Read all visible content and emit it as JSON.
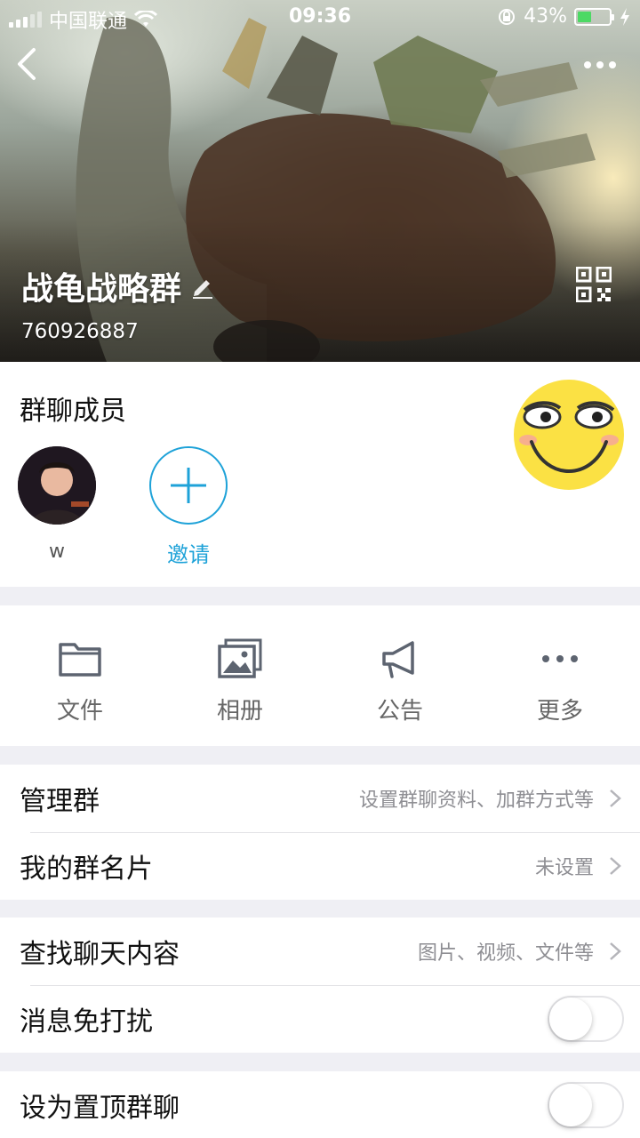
{
  "status_bar": {
    "carrier": "中国联通",
    "time": "09:36",
    "battery": "43%",
    "battery_level": 0.43
  },
  "header": {
    "group_name": "战龟战略群",
    "group_id": "760926887"
  },
  "members": {
    "title": "群聊成员",
    "list": [
      {
        "name": "w"
      }
    ],
    "invite_label": "邀请"
  },
  "features": [
    {
      "label": "文件",
      "icon": "folder-icon"
    },
    {
      "label": "相册",
      "icon": "photo-album-icon"
    },
    {
      "label": "公告",
      "icon": "megaphone-icon"
    },
    {
      "label": "更多",
      "icon": "more-dots-icon"
    }
  ],
  "settings": {
    "manage_group": {
      "label": "管理群",
      "value": "设置群聊资料、加群方式等"
    },
    "my_card": {
      "label": "我的群名片",
      "value": "未设置"
    },
    "search_chat": {
      "label": "查找聊天内容",
      "value": "图片、视频、文件等"
    },
    "do_not_disturb": {
      "label": "消息免打扰",
      "on": false
    },
    "pin_top": {
      "label": "设为置顶群聊",
      "on": false
    }
  },
  "colors": {
    "accent": "#1ea2d8",
    "battery": "#4cd964",
    "icon_gray": "#5d6470"
  }
}
